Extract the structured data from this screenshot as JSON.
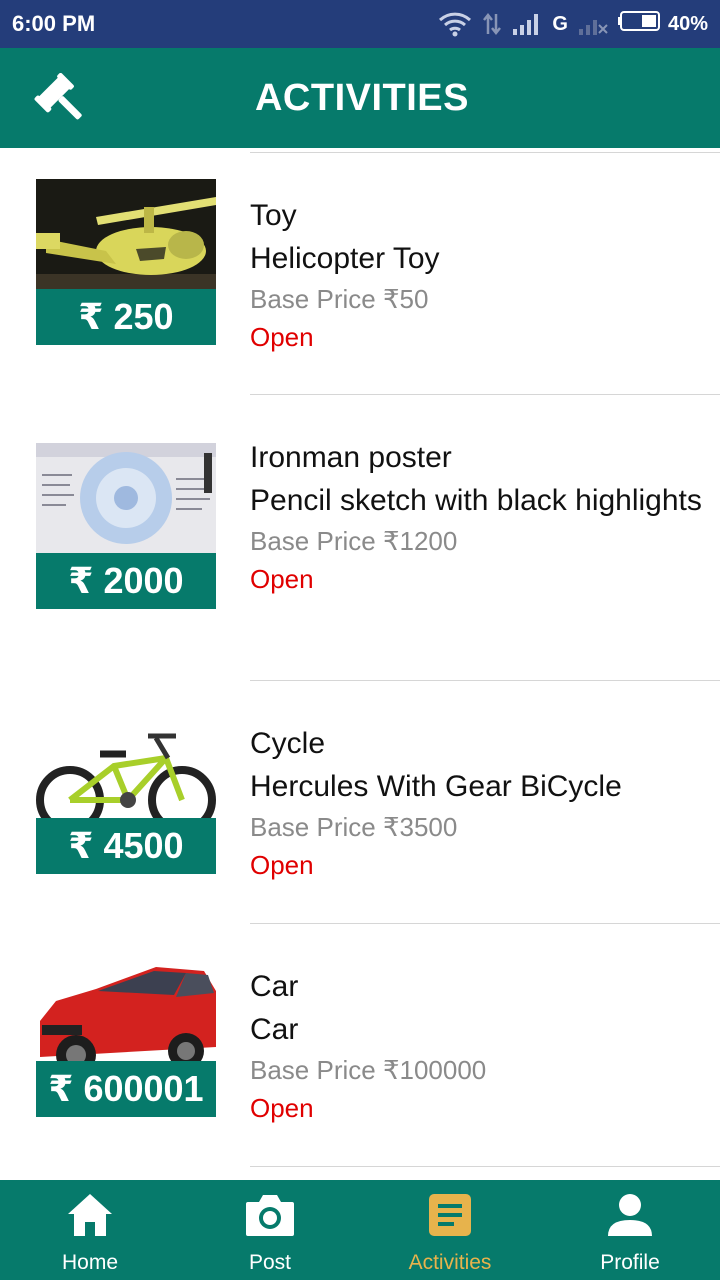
{
  "status_bar": {
    "time": "6:00 PM",
    "network": "G",
    "battery": "40%"
  },
  "app_bar": {
    "title": "ACTIVITIES",
    "logo_icon": "gavel-icon"
  },
  "items": [
    {
      "title": "Toy",
      "description": "Helicopter Toy",
      "base_price": "Base Price ₹50",
      "price": "250",
      "currency": "₹",
      "status": "Open"
    },
    {
      "title": "Ironman poster",
      "description": "Pencil sketch with black highlights",
      "base_price": "Base Price ₹1200",
      "price": "2000",
      "currency": "₹",
      "status": "Open"
    },
    {
      "title": "Cycle",
      "description": "Hercules With Gear BiCycle",
      "base_price": "Base Price ₹3500",
      "price": "4500",
      "currency": "₹",
      "status": "Open"
    },
    {
      "title": "Car",
      "description": "Car",
      "base_price": "Base Price ₹100000",
      "price": "600001",
      "currency": "₹",
      "status": "Open"
    }
  ],
  "bottom_nav": {
    "items": [
      {
        "label": "Home",
        "icon": "home-icon"
      },
      {
        "label": "Post",
        "icon": "camera-icon"
      },
      {
        "label": "Activities",
        "icon": "activities-icon",
        "active": true
      },
      {
        "label": "Profile",
        "icon": "profile-icon"
      }
    ]
  },
  "colors": {
    "status_bar": "#243d7a",
    "primary": "#067a6b",
    "active_nav": "#e7b34c",
    "open_status": "#e00000"
  }
}
